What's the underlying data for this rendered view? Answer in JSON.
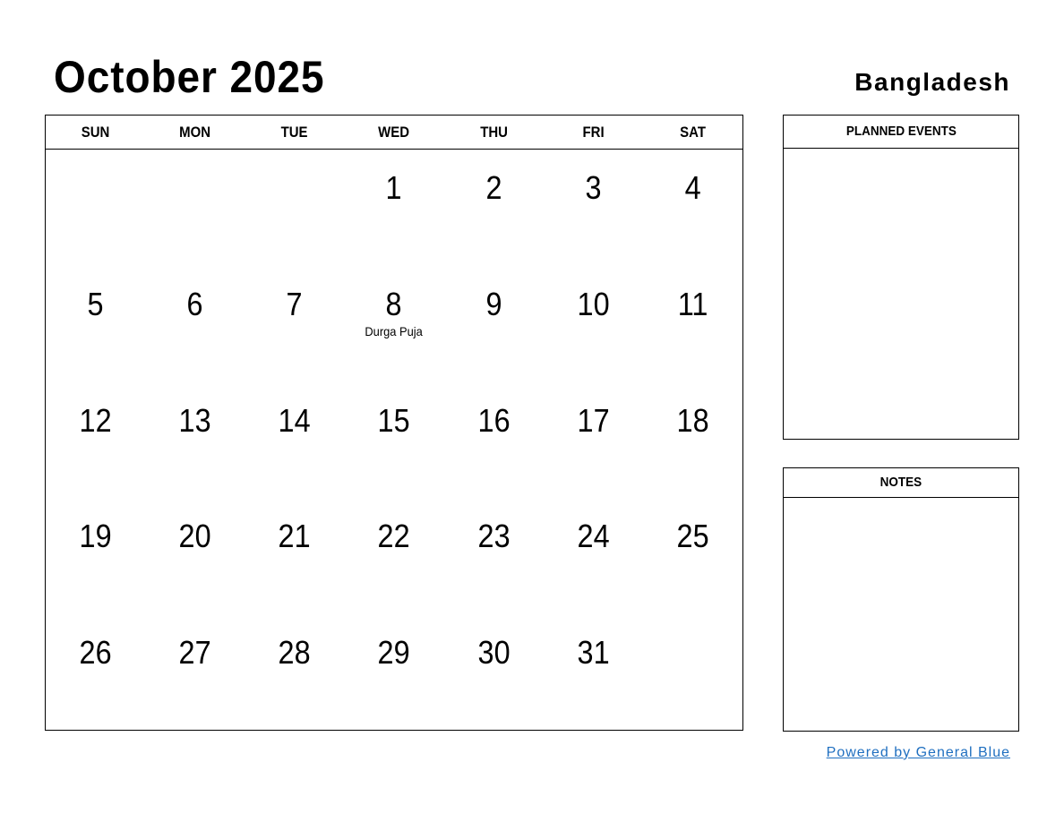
{
  "header": {
    "title": "October 2025",
    "country": "Bangladesh"
  },
  "calendar": {
    "days_of_week": [
      "SUN",
      "MON",
      "TUE",
      "WED",
      "THU",
      "FRI",
      "SAT"
    ],
    "weeks": [
      [
        {
          "day": ""
        },
        {
          "day": ""
        },
        {
          "day": ""
        },
        {
          "day": "1"
        },
        {
          "day": "2"
        },
        {
          "day": "3"
        },
        {
          "day": "4"
        }
      ],
      [
        {
          "day": "5"
        },
        {
          "day": "6"
        },
        {
          "day": "7"
        },
        {
          "day": "8",
          "event": "Durga Puja"
        },
        {
          "day": "9"
        },
        {
          "day": "10"
        },
        {
          "day": "11"
        }
      ],
      [
        {
          "day": "12"
        },
        {
          "day": "13"
        },
        {
          "day": "14"
        },
        {
          "day": "15"
        },
        {
          "day": "16"
        },
        {
          "day": "17"
        },
        {
          "day": "18"
        }
      ],
      [
        {
          "day": "19"
        },
        {
          "day": "20"
        },
        {
          "day": "21"
        },
        {
          "day": "22"
        },
        {
          "day": "23"
        },
        {
          "day": "24"
        },
        {
          "day": "25"
        }
      ],
      [
        {
          "day": "26"
        },
        {
          "day": "27"
        },
        {
          "day": "28"
        },
        {
          "day": "29"
        },
        {
          "day": "30"
        },
        {
          "day": "31"
        },
        {
          "day": ""
        }
      ]
    ]
  },
  "panels": {
    "planned_events": "PLANNED EVENTS",
    "notes": "NOTES"
  },
  "footer": {
    "powered_by": "Powered by General Blue",
    "link_color": "#1f6fc0"
  }
}
